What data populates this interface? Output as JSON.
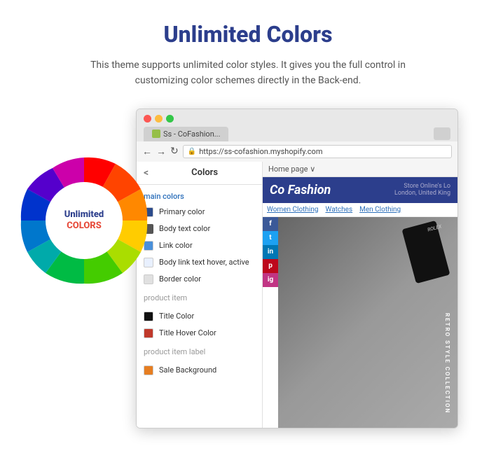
{
  "page": {
    "title": "Unlimited Colors",
    "subtitle": "This theme supports unlimited color styles. It gives you the full control in customizing color schemes directly in the Back-end."
  },
  "colorWheel": {
    "text_line1": "Unlimited",
    "text_line2": "COLORS"
  },
  "browser": {
    "tab_label": "Ss - CoFashion...",
    "address": "https://ss-cofashion.myshopify.com"
  },
  "shopify": {
    "sidebar_back": "<",
    "sidebar_title": "Colors",
    "homepage_label": "Home page ∨",
    "main_colors_section": "main colors",
    "color_options": [
      {
        "label": "Primary color",
        "swatch": "dark-blue"
      },
      {
        "label": "Body text color",
        "swatch": "dark-gray"
      },
      {
        "label": "Link color",
        "swatch": "blue-link"
      },
      {
        "label": "Body link text hover, active",
        "swatch": "hover-blue"
      },
      {
        "label": "Border color",
        "swatch": "border-light"
      }
    ],
    "product_item_section": "product item",
    "product_item_options": [
      {
        "label": "Title Color",
        "swatch": "black"
      },
      {
        "label": "Title Hover Color",
        "swatch": "dark-red"
      }
    ],
    "product_item_label_section": "product item label",
    "product_label_options": [
      {
        "label": "Sale Background",
        "swatch": "orange"
      }
    ]
  },
  "preview": {
    "topbar": "Home page ∨",
    "store_name": "Co Fashion",
    "store_info": "Store Online's Lo\nLondon, United King",
    "nav_links": [
      "Women Clothing",
      "Watches",
      "Men Clothing"
    ],
    "social_icons": [
      "f",
      "t",
      "in",
      "p",
      "ig"
    ],
    "hero_text": "RETRO STYLE COLLECTION"
  }
}
